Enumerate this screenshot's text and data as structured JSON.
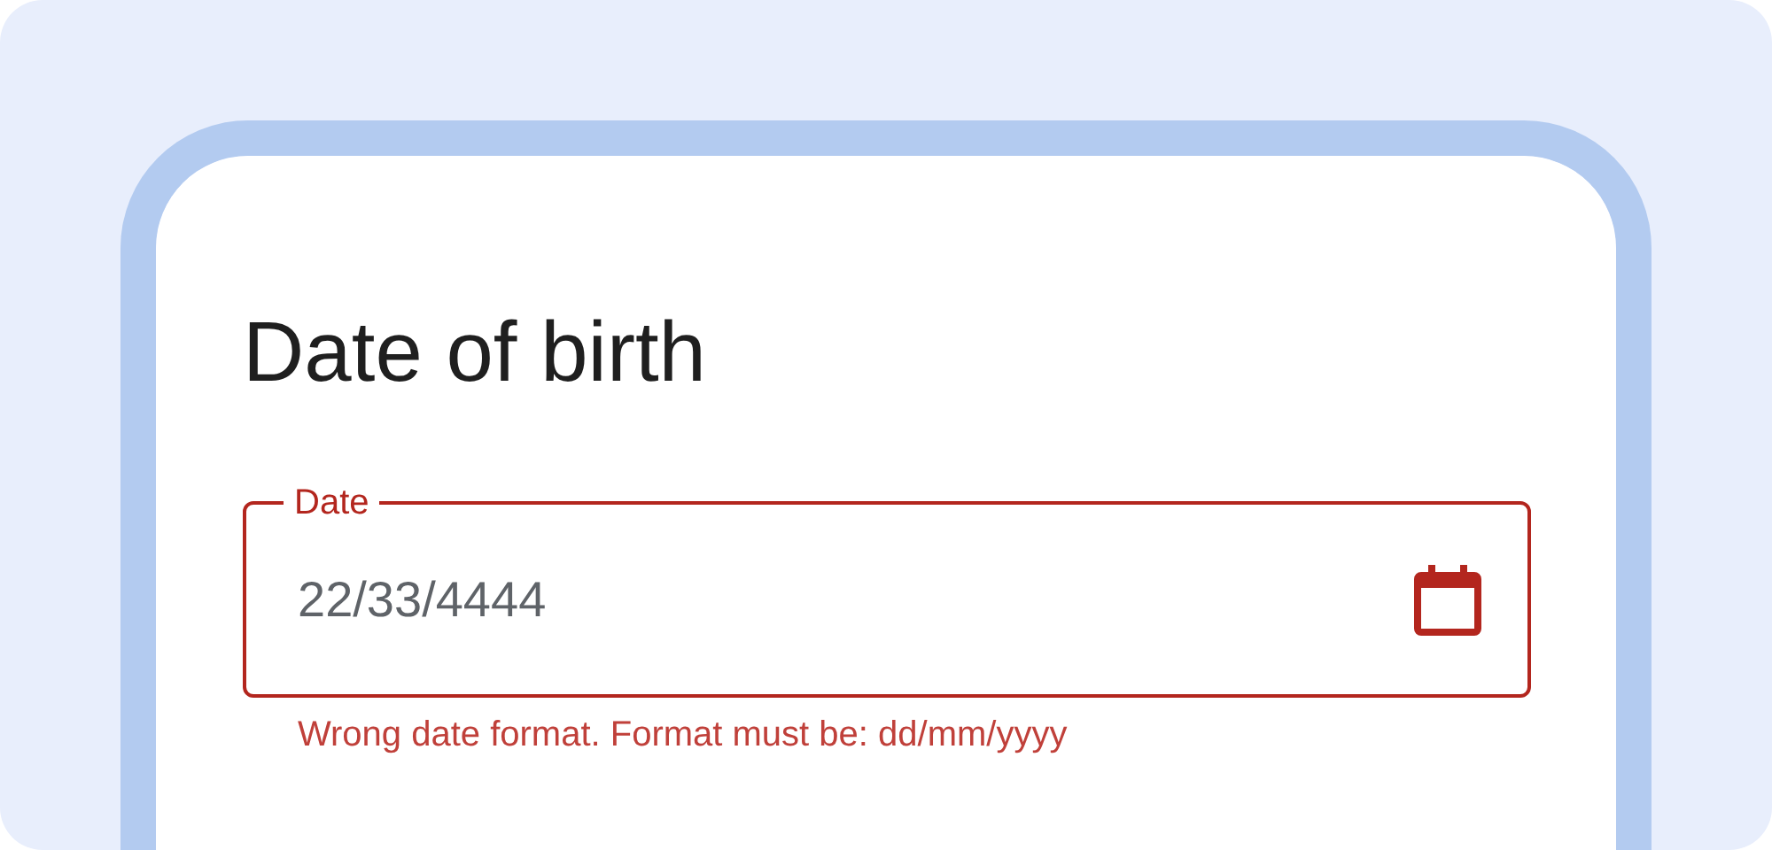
{
  "title": "Date of birth",
  "date_field": {
    "label": "Date",
    "value": "22/33/4444",
    "error": true,
    "error_text": "Wrong date format. Format must be: dd/mm/yyyy"
  }
}
